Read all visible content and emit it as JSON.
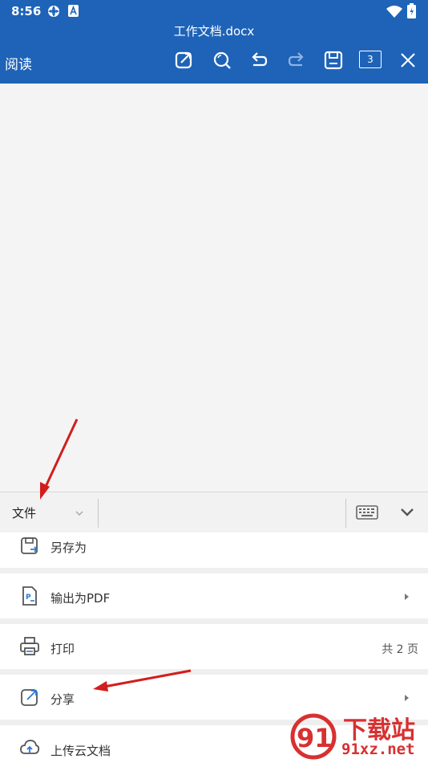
{
  "status": {
    "time": "8:56"
  },
  "document": {
    "title": "工作文档.docx"
  },
  "toolbar": {
    "mode_label": "阅读",
    "page_count": "3"
  },
  "tabbar": {
    "current_tab": "文件"
  },
  "menu": {
    "items": [
      {
        "label": "另存为"
      },
      {
        "label": "输出为PDF"
      },
      {
        "label": "打印",
        "extra": "共 2 页"
      },
      {
        "label": "分享"
      },
      {
        "label": "上传云文档"
      }
    ]
  },
  "watermark": {
    "text_cn": "下载站",
    "text_url": "91xz.net",
    "logo_text": "91"
  },
  "colors": {
    "primary": "#1e63b8",
    "annotation_arrow": "#d31d1d",
    "icon_accent": "#2a79d6"
  }
}
